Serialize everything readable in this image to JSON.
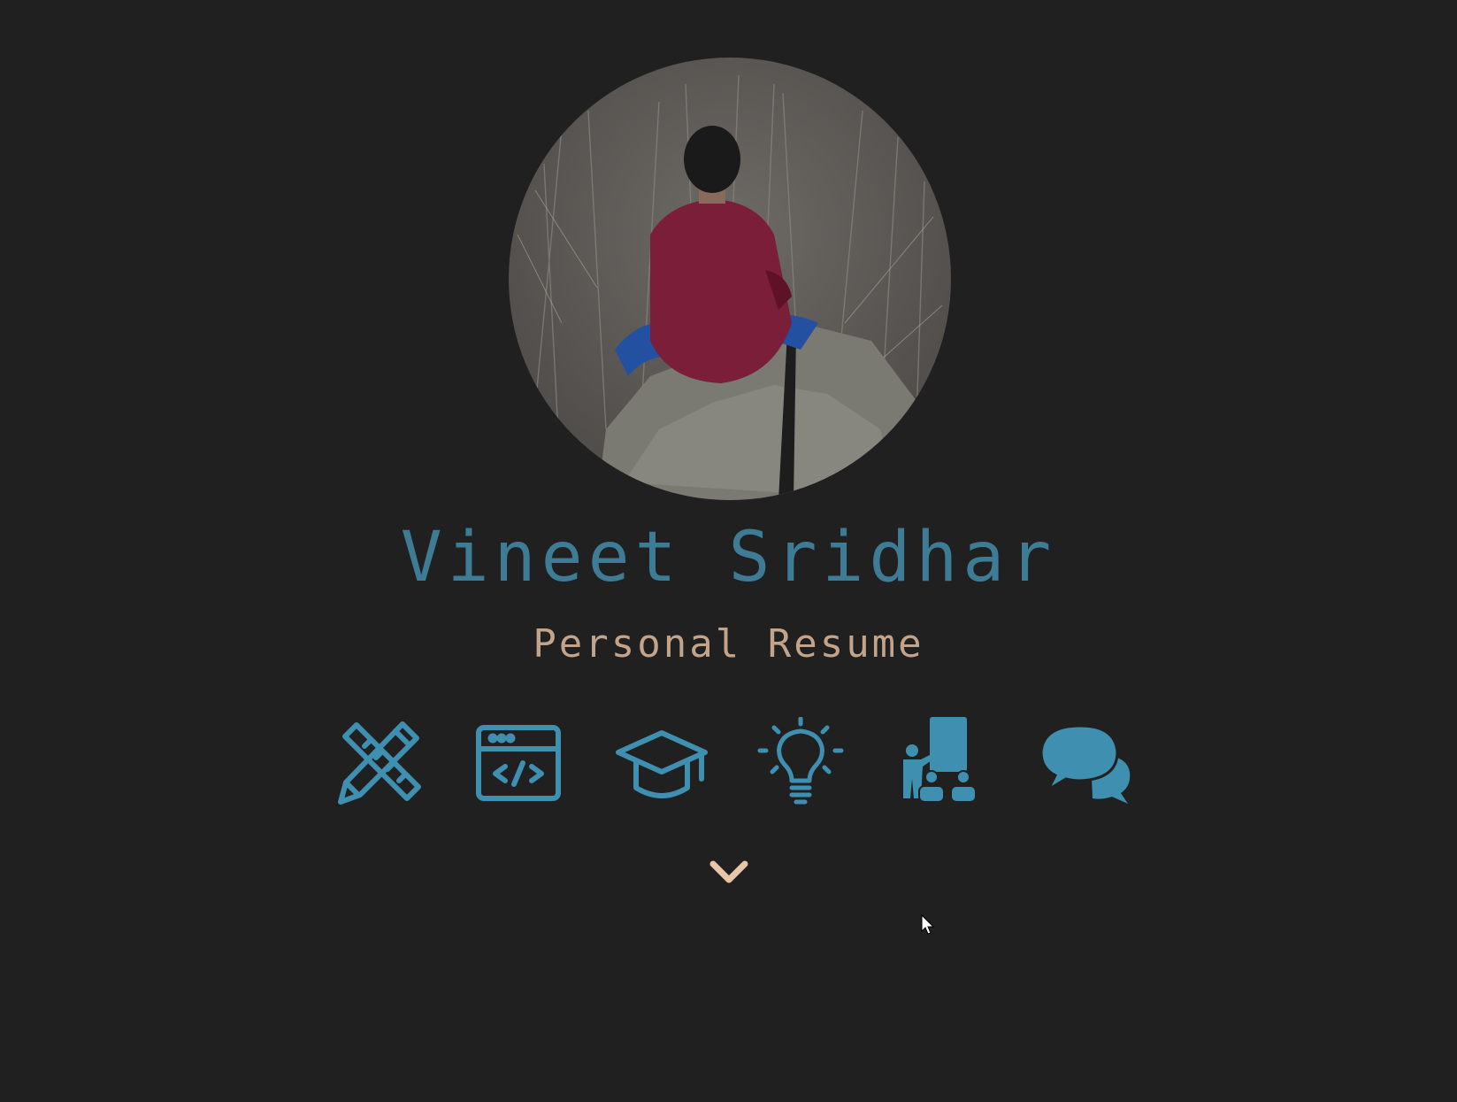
{
  "profile": {
    "name": "Vineet Sridhar",
    "subtitle": "Personal Resume",
    "avatar_description": "profile-photo"
  },
  "nav_icons": [
    {
      "icon": "pencil-ruler-icon"
    },
    {
      "icon": "code-window-icon"
    },
    {
      "icon": "graduation-cap-icon"
    },
    {
      "icon": "lightbulb-icon"
    },
    {
      "icon": "teacher-presentation-icon"
    },
    {
      "icon": "chat-bubbles-icon"
    }
  ],
  "scroll": {
    "icon": "chevron-down-icon"
  },
  "colors": {
    "background": "#202020",
    "accent_blue": "#3e8fb0",
    "name_blue": "#3e7c96",
    "subtitle_tan": "#c3a48b",
    "chevron": "#e8c6a8"
  }
}
